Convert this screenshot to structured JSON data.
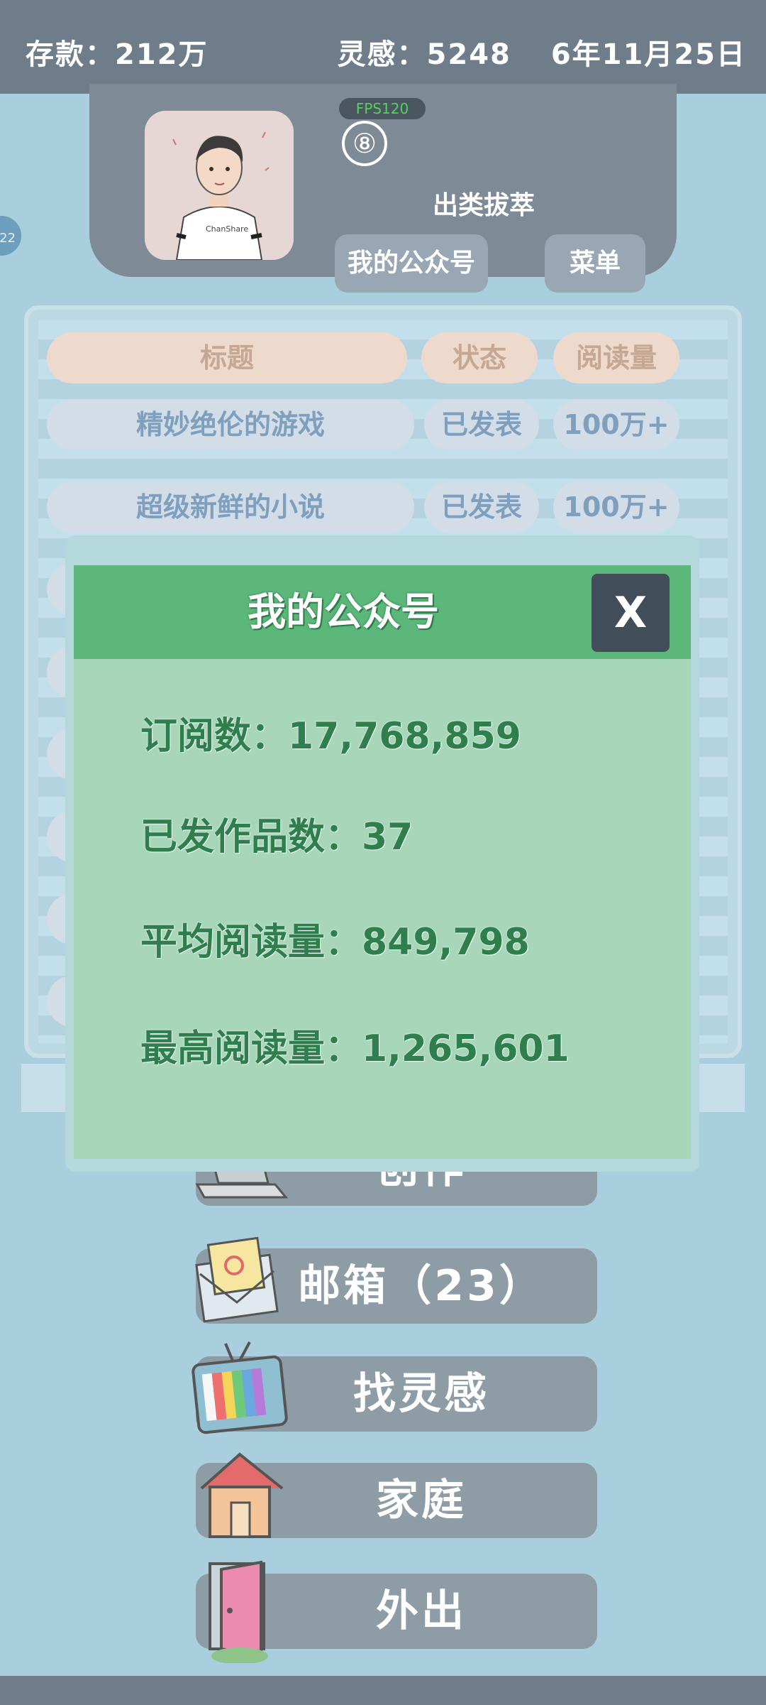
{
  "status": {
    "savings": "存款：212万",
    "inspiration": "灵感：5248",
    "date": "6年11月25日"
  },
  "profile": {
    "fps": "FPS120",
    "level": "⑧",
    "rank": "出类拔萃",
    "shirt_text": "ChanShare",
    "coin_badge": "22",
    "btn_official_account": "我的公众号",
    "btn_menu": "菜单"
  },
  "table": {
    "headers": [
      "标题",
      "状态",
      "阅读量"
    ],
    "rows": [
      {
        "title": "精妙绝伦的游戏",
        "status": "已发表",
        "reads": "100万+"
      },
      {
        "title": "超级新鲜的小说",
        "status": "已发表",
        "reads": "100万+"
      }
    ]
  },
  "menu": {
    "create": "创作",
    "mailbox": "邮箱（23）",
    "inspiration": "找灵感",
    "family": "家庭",
    "outing": "外出"
  },
  "modal": {
    "title": "我的公众号",
    "close": "X",
    "subscribers": "订阅数：17,768,859",
    "works": "已发作品数：37",
    "avg_reads": "平均阅读量：849,798",
    "max_reads": "最高阅读量：1,265,601"
  }
}
